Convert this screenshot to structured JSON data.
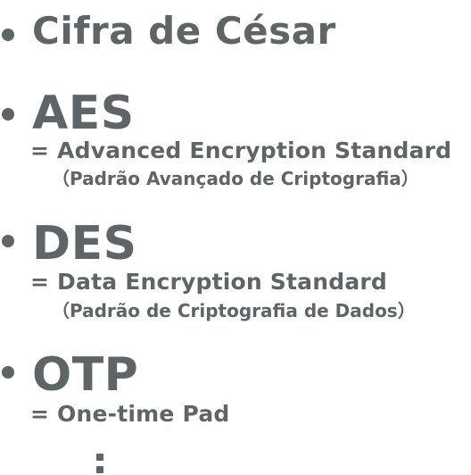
{
  "items": [
    {
      "title": "Cifra de César",
      "expansion": "",
      "translation": ""
    },
    {
      "title": "AES",
      "expansion": "= Advanced Encryption Standard",
      "translation": "（Padrão Avançado de Criptografia）"
    },
    {
      "title": "DES",
      "expansion": "= Data Encryption Standard",
      "translation": "（Padrão de Criptografia de Dados）"
    },
    {
      "title": "OTP",
      "expansion": "= One-time Pad",
      "translation": ""
    }
  ],
  "continuation": "⋮",
  "colors": {
    "text": "#5f6567",
    "background": "#ffffff"
  }
}
